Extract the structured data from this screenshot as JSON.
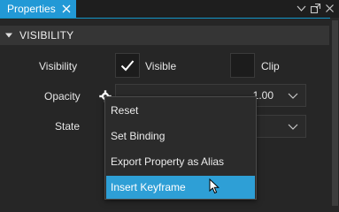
{
  "panel": {
    "tab_label": "Properties"
  },
  "section": {
    "title": "VISIBILITY"
  },
  "rows": {
    "visibility": {
      "label": "Visibility",
      "checkbox_label": "Visible",
      "checked": true
    },
    "clip": {
      "checkbox_label": "Clip",
      "checked": false
    },
    "opacity": {
      "label": "Opacity",
      "value": "1.00"
    },
    "state": {
      "label": "State",
      "value": ""
    }
  },
  "context_menu": {
    "items": [
      {
        "label": "Reset"
      },
      {
        "label": "Set Binding"
      },
      {
        "label": "Export Property as Alias"
      },
      {
        "label": "Insert Keyframe",
        "highlighted": true
      }
    ]
  },
  "colors": {
    "accent": "#2299d6",
    "menu_highlight": "#2e9fd6",
    "background": "#262626"
  }
}
